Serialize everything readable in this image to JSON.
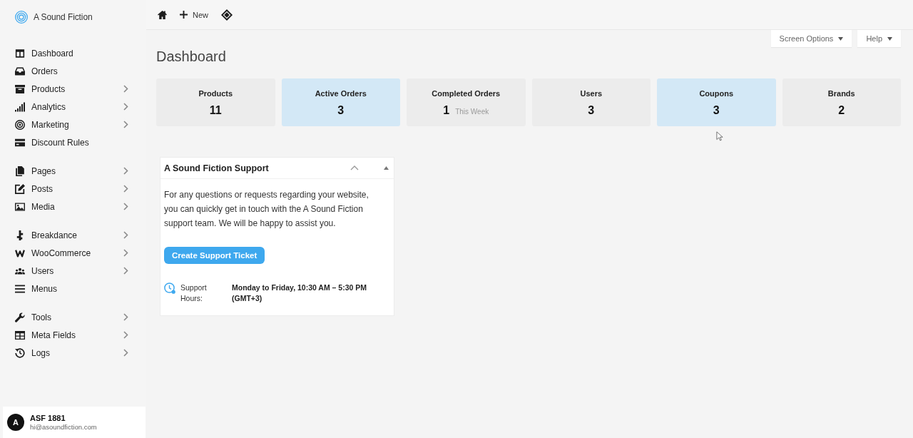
{
  "sidebar": {
    "brand": "A Sound Fiction",
    "groups": [
      {
        "items": [
          {
            "label": "Dashboard",
            "submenu": false
          },
          {
            "label": "Orders",
            "submenu": false
          },
          {
            "label": "Products",
            "submenu": true
          },
          {
            "label": "Analytics",
            "submenu": true
          },
          {
            "label": "Marketing",
            "submenu": true
          },
          {
            "label": "Discount Rules",
            "submenu": false
          }
        ]
      },
      {
        "items": [
          {
            "label": "Pages",
            "submenu": true
          },
          {
            "label": "Posts",
            "submenu": true
          },
          {
            "label": "Media",
            "submenu": true
          }
        ]
      },
      {
        "items": [
          {
            "label": "Breakdance",
            "submenu": true
          },
          {
            "label": "WooCommerce",
            "submenu": true
          },
          {
            "label": "Users",
            "submenu": true
          },
          {
            "label": "Menus",
            "submenu": false
          }
        ]
      },
      {
        "items": [
          {
            "label": "Tools",
            "submenu": true
          },
          {
            "label": "Meta Fields",
            "submenu": true
          },
          {
            "label": "Logs",
            "submenu": true
          }
        ]
      }
    ],
    "user": {
      "initial": "A",
      "name": "ASF 1881",
      "email": "hi@asoundfiction.com"
    }
  },
  "toolbar": {
    "new_label": "New"
  },
  "screen_meta": [
    "Screen Options",
    "Help"
  ],
  "page_title": "Dashboard",
  "stats": [
    {
      "label": "Products",
      "value": "11",
      "highlighted": false
    },
    {
      "label": "Active Orders",
      "value": "3",
      "highlighted": true
    },
    {
      "label": "Completed Orders",
      "value": "1",
      "note": "This Week",
      "highlighted": false
    },
    {
      "label": "Users",
      "value": "3",
      "highlighted": false
    },
    {
      "label": "Coupons",
      "value": "3",
      "highlighted": true
    },
    {
      "label": "Brands",
      "value": "2",
      "highlighted": false
    }
  ],
  "support_widget": {
    "title": "A Sound Fiction Support",
    "text": "For any questions or requests regarding your website, you can quickly get in touch with the A Sound Fiction support team. We will be happy to assist you.",
    "button": "Create Support Ticket",
    "hours_label": "Support Hours:",
    "hours": "Monday to Friday, 10:30 AM – 5:30 PM (GMT+3)"
  }
}
